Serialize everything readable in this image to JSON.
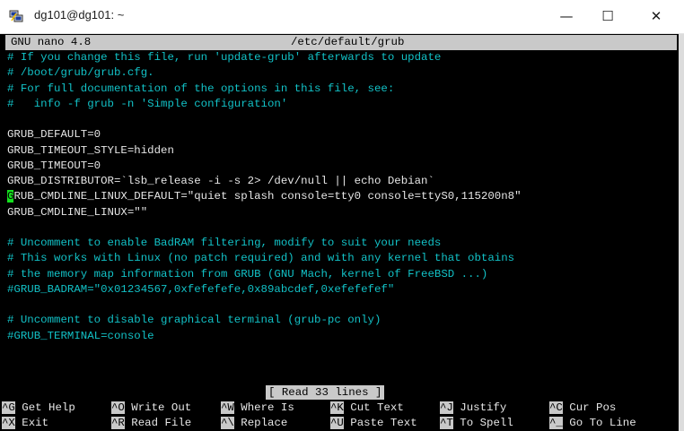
{
  "window": {
    "title": "dg101@dg101: ~",
    "minimize": "—",
    "maximize": "☐",
    "close": "✕"
  },
  "nano": {
    "version": "GNU nano 4.8",
    "filename": "/etc/default/grub",
    "lines": [
      {
        "text": "# If you change this file, run 'update-grub' afterwards to update",
        "kind": "comment"
      },
      {
        "text": "# /boot/grub/grub.cfg.",
        "kind": "comment"
      },
      {
        "text": "# For full documentation of the options in this file, see:",
        "kind": "comment"
      },
      {
        "text": "#   info -f grub -n 'Simple configuration'",
        "kind": "comment"
      },
      {
        "text": "",
        "kind": "blank"
      },
      {
        "text": "GRUB_DEFAULT=0",
        "kind": "code"
      },
      {
        "text": "GRUB_TIMEOUT_STYLE=hidden",
        "kind": "code"
      },
      {
        "text": "GRUB_TIMEOUT=0",
        "kind": "code"
      },
      {
        "text": "GRUB_DISTRIBUTOR=`lsb_release -i -s 2> /dev/null || echo Debian`",
        "kind": "code"
      },
      {
        "text": "GRUB_CMDLINE_LINUX_DEFAULT=\"quiet splash console=tty0 console=ttyS0,115200n8\"",
        "kind": "code",
        "cursor": true
      },
      {
        "text": "GRUB_CMDLINE_LINUX=\"\"",
        "kind": "code"
      },
      {
        "text": "",
        "kind": "blank"
      },
      {
        "text": "# Uncomment to enable BadRAM filtering, modify to suit your needs",
        "kind": "comment"
      },
      {
        "text": "# This works with Linux (no patch required) and with any kernel that obtains",
        "kind": "comment"
      },
      {
        "text": "# the memory map information from GRUB (GNU Mach, kernel of FreeBSD ...)",
        "kind": "comment"
      },
      {
        "text": "#GRUB_BADRAM=\"0x01234567,0xfefefefe,0x89abcdef,0xefefefef\"",
        "kind": "comment"
      },
      {
        "text": "",
        "kind": "blank"
      },
      {
        "text": "# Uncomment to disable graphical terminal (grub-pc only)",
        "kind": "comment"
      },
      {
        "text": "#GRUB_TERMINAL=console",
        "kind": "comment"
      }
    ],
    "status": "[ Read 33 lines ]",
    "shortcuts_row1": [
      {
        "key": "^G",
        "label": "Get Help"
      },
      {
        "key": "^O",
        "label": "Write Out"
      },
      {
        "key": "^W",
        "label": "Where Is"
      },
      {
        "key": "^K",
        "label": "Cut Text"
      },
      {
        "key": "^J",
        "label": "Justify"
      },
      {
        "key": "^C",
        "label": "Cur Pos"
      }
    ],
    "shortcuts_row2": [
      {
        "key": "^X",
        "label": "Exit"
      },
      {
        "key": "^R",
        "label": "Read File"
      },
      {
        "key": "^\\",
        "label": "Replace"
      },
      {
        "key": "^U",
        "label": "Paste Text"
      },
      {
        "key": "^T",
        "label": "To Spell"
      },
      {
        "key": "^_",
        "label": "Go To Line"
      }
    ]
  },
  "colors": {
    "comment": "#12c1c6",
    "code": "#e6e6e6",
    "cursor": "#14e01e",
    "bar": "#c9c9c9"
  }
}
